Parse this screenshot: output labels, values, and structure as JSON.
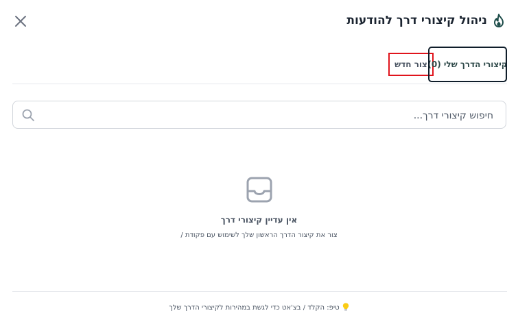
{
  "header": {
    "title": "ניהול קיצורי דרך להודעות",
    "flame_icon": "flame-icon",
    "close_icon": "close-icon"
  },
  "tabs": {
    "my_shortcuts": "קיצורי הדרך שלי (0)",
    "create_new": "צור חדש"
  },
  "search": {
    "placeholder": "חיפוש קיצורי דרך...",
    "icon": "search-icon"
  },
  "empty_state": {
    "icon": "inbox-icon",
    "title": "אין עדיין קיצורי דרך",
    "subtitle": "צור את קיצור הדרך הראשון שלך לשימוש עם פקודת /"
  },
  "footer": {
    "tip": "טיפ: הקלד / בצ'אט כדי לגשת במהירות לקיצורי הדרך שלך",
    "tip_icon": "lightbulb-icon"
  },
  "colors": {
    "accent": "#1e4d4a",
    "highlight": "#e0141c",
    "divider": "#e5e7eb"
  }
}
